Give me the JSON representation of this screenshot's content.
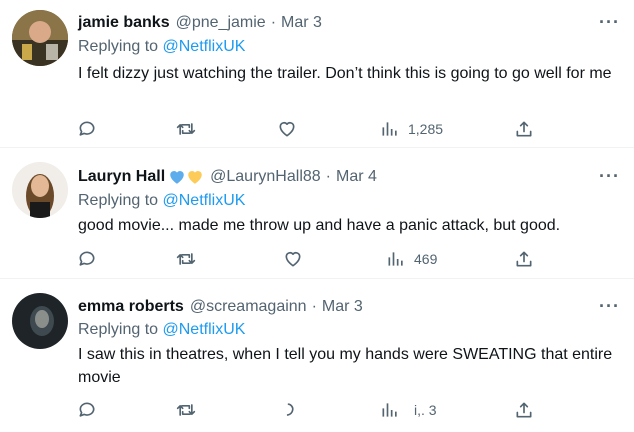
{
  "reply_prefix": "Replying to",
  "more_label": "···",
  "colors": {
    "accent": "#1d9bf0",
    "muted": "#536471",
    "text": "#0f1419"
  },
  "tweets": [
    {
      "name": "jamie banks",
      "handle": "@pne_jamie",
      "date": "Mar 3",
      "reply_to": "@NetflixUK",
      "text": "I felt dizzy just watching the trailer. Don’t think this is going to go well for me",
      "views": "1,285"
    },
    {
      "name": "Lauryn Hall",
      "name_emoji": [
        "blue-heart-icon",
        "yellow-heart-icon"
      ],
      "handle": "@LaurynHall88",
      "date": "Mar 4",
      "reply_to": "@NetflixUK",
      "text": "good movie... made me throw up and have a panic attack, but good.",
      "views": "469"
    },
    {
      "name": "emma roberts",
      "handle": "@screamagainn",
      "date": "Mar 3",
      "reply_to": "@NetflixUK",
      "text": "I saw this in theatres, when I tell you my hands were SWEATING that entire movie",
      "views": "i,. 3"
    }
  ]
}
